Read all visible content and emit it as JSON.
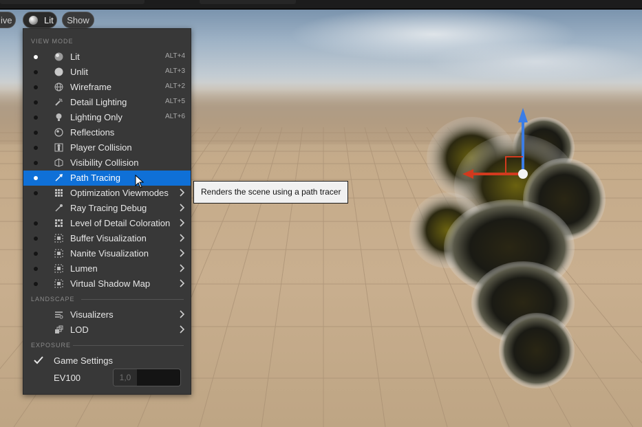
{
  "toolbar": {
    "perspective_label": "ive",
    "lit_label": "Lit",
    "show_label": "Show"
  },
  "menu": {
    "view_mode": {
      "title": "VIEW MODE",
      "items": [
        {
          "label": "Lit",
          "shortcut": "ALT+4",
          "icon": "lit-sphere-icon",
          "selected": true
        },
        {
          "label": "Unlit",
          "shortcut": "ALT+3",
          "icon": "unlit-sphere-icon"
        },
        {
          "label": "Wireframe",
          "shortcut": "ALT+2",
          "icon": "wireframe-icon"
        },
        {
          "label": "Detail Lighting",
          "shortcut": "ALT+5",
          "icon": "detail-lighting-icon"
        },
        {
          "label": "Lighting Only",
          "shortcut": "ALT+6",
          "icon": "lightbulb-icon"
        },
        {
          "label": "Reflections",
          "shortcut": "",
          "icon": "reflections-icon"
        },
        {
          "label": "Player Collision",
          "shortcut": "",
          "icon": "player-collision-icon"
        },
        {
          "label": "Visibility Collision",
          "shortcut": "",
          "icon": "visibility-collision-icon"
        },
        {
          "label": "Path Tracing",
          "shortcut": "",
          "icon": "path-tracing-icon",
          "highlighted": true
        },
        {
          "label": "Optimization Viewmodes",
          "submenu": true,
          "icon": "grid-icon"
        },
        {
          "label": "Ray Tracing Debug",
          "submenu": true,
          "icon": "ray-tracing-icon",
          "no_radio": true
        },
        {
          "label": "Level of Detail Coloration",
          "submenu": true,
          "icon": "grid-icon"
        },
        {
          "label": "Buffer Visualization",
          "submenu": true,
          "icon": "buffer-icon"
        },
        {
          "label": "Nanite Visualization",
          "submenu": true,
          "icon": "buffer-icon"
        },
        {
          "label": "Lumen",
          "submenu": true,
          "icon": "buffer-icon"
        },
        {
          "label": "Virtual Shadow Map",
          "submenu": true,
          "icon": "buffer-icon"
        }
      ]
    },
    "landscape": {
      "title": "LANDSCAPE",
      "items": [
        {
          "label": "Visualizers",
          "submenu": true,
          "icon": "visualizers-icon"
        },
        {
          "label": "LOD",
          "submenu": true,
          "icon": "lod-icon"
        }
      ]
    },
    "exposure": {
      "title": "EXPOSURE",
      "game_settings_label": "Game Settings",
      "ev100_label": "EV100",
      "ev100_value": "1,0"
    }
  },
  "tooltip": {
    "text": "Renders the scene using a path tracer"
  },
  "colors": {
    "highlight": "#0f70d7",
    "menu_bg": "#383838",
    "gizmo_x": "#d23a1e",
    "gizmo_z": "#3b7de6"
  }
}
